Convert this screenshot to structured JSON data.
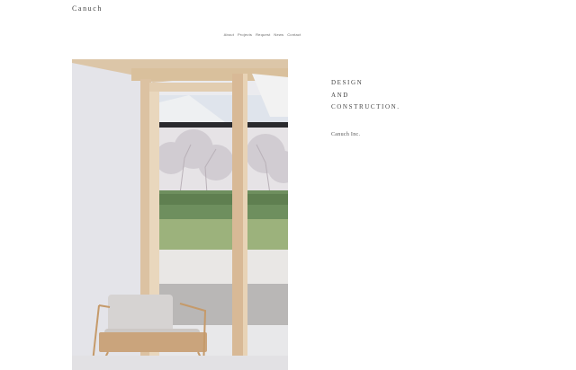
{
  "brand": {
    "logo": "Canuch"
  },
  "nav": {
    "items": [
      {
        "label": "About"
      },
      {
        "label": "Projects"
      },
      {
        "label": "Request"
      },
      {
        "label": "News"
      },
      {
        "label": "Contact"
      }
    ]
  },
  "headline": {
    "lines": [
      "DESIGN",
      "AND",
      "CONSTRUCTION."
    ]
  },
  "company": {
    "name": "Canuch Inc."
  },
  "hero": {
    "icon": "hero-photo"
  }
}
